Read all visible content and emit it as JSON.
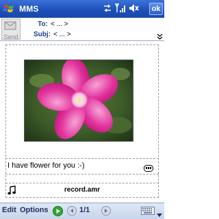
{
  "titlebar": {
    "app_title": "MMS",
    "ok_label": "ok"
  },
  "header": {
    "send_label": "Send",
    "to_label": "To:",
    "to_value": "< ... >",
    "subj_label": "Subj:",
    "subj_value": "< ... >"
  },
  "slide": {
    "text": "I have flower for you :-)",
    "audio_file": "record.amr"
  },
  "menubar": {
    "edit_label": "Edit",
    "options_label": "Options",
    "page_indicator": "1/1"
  },
  "colors": {
    "titlebar": "#1c4fb8",
    "menubar": "#c7d4ea",
    "play_green": "#2ea82e"
  }
}
